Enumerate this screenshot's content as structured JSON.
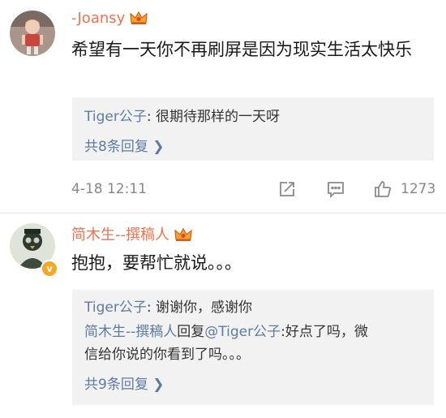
{
  "comments": [
    {
      "username": "-Joansy",
      "text": "希望有一天你不再刷屏是因为现实生活太快乐",
      "replies": {
        "line1_user": "Tiger公子",
        "line1_text": ": 很期待那样的一天呀",
        "more": "共8条回复 ❯"
      },
      "time": "4-18 12:11",
      "likes": "1273"
    },
    {
      "username": "简木生--撰稿人",
      "verified_badge": "v",
      "text": "抱抱，要帮忙就说。。。",
      "replies": {
        "line1_user": "Tiger公子",
        "line1_text": ": 谢谢你，感谢你",
        "line2_user": "简木生--撰稿人",
        "line2_reply_word": "回复",
        "line2_target": "@Tiger公子",
        "line2_text_a": ":好点了吗，微",
        "line2_text_b": "信给你说的你看到了吗。。。",
        "more": "共9条回复 ❯"
      }
    }
  ],
  "colors": {
    "username": "#eb7350",
    "link": "#5d7ba6",
    "reply_bg": "#f2f2f2",
    "crown": "#f5a623"
  },
  "icons": [
    "crown-icon",
    "share-icon",
    "comment-icon",
    "like-icon",
    "verified-icon"
  ]
}
